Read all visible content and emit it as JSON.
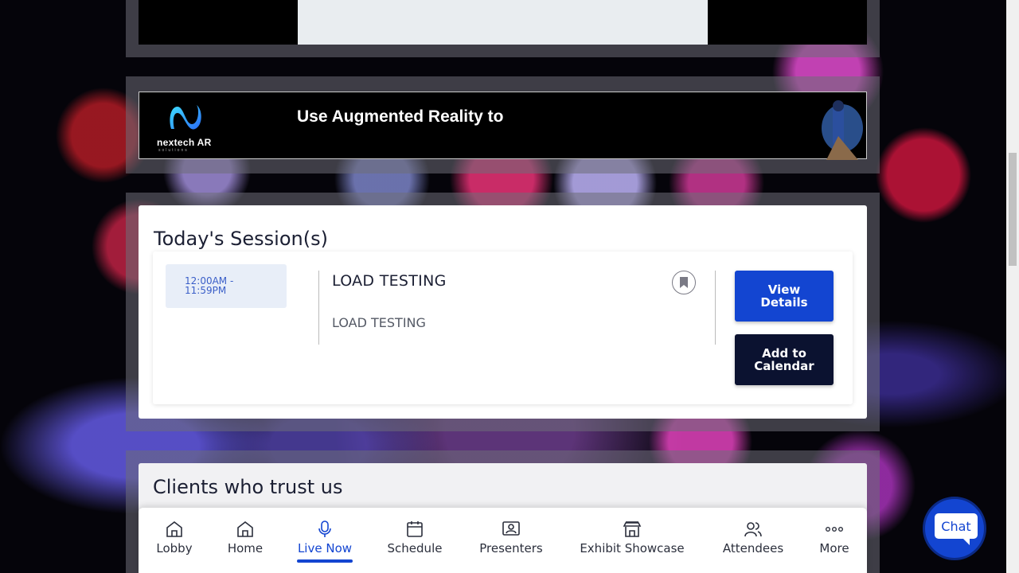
{
  "banner": {
    "logo_text": "nextech AR",
    "logo_sub": "solutions",
    "headline": "Use Augmented Reality to"
  },
  "sessions": {
    "title": "Today's Session(s)",
    "items": [
      {
        "time_start": "12:00AM -",
        "time_end": "11:59PM",
        "title": "LOAD TESTING",
        "description": "LOAD TESTING",
        "view_details_label": "View Details",
        "add_calendar_label": "Add to Calendar"
      }
    ]
  },
  "clients": {
    "title": "Clients who trust us"
  },
  "nav": {
    "items": [
      {
        "label": "Lobby",
        "icon": "home-icon"
      },
      {
        "label": "Home",
        "icon": "home-icon"
      },
      {
        "label": "Live Now",
        "icon": "microphone-icon",
        "active": true
      },
      {
        "label": "Schedule",
        "icon": "calendar-icon"
      },
      {
        "label": "Presenters",
        "icon": "presenter-icon"
      },
      {
        "label": "Exhibit Showcase",
        "icon": "store-icon"
      },
      {
        "label": "Attendees",
        "icon": "users-icon"
      },
      {
        "label": "More",
        "icon": "more-icon"
      }
    ]
  },
  "chat": {
    "label": "Chat"
  },
  "colors": {
    "accent": "#1345d1",
    "dark_button": "#0b1230",
    "time_pill_bg": "#e8eef8"
  }
}
